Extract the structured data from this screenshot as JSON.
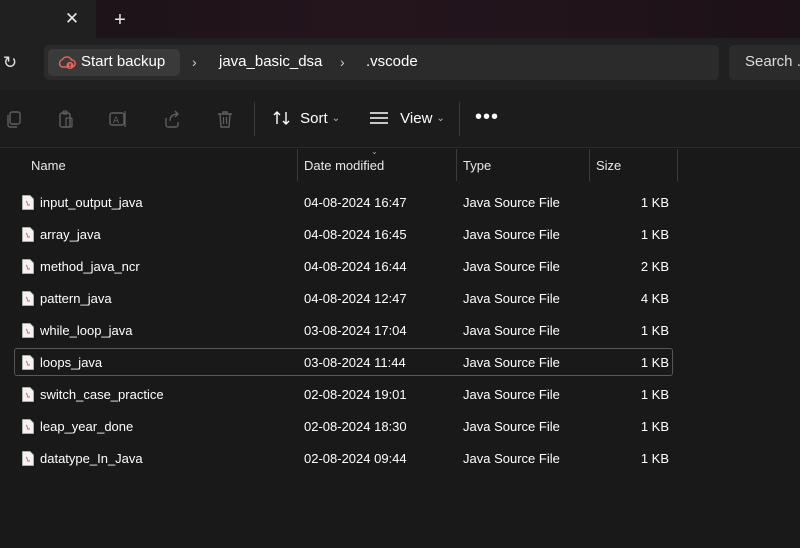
{
  "tabs": {
    "close_glyph": "✕",
    "new_glyph": "+"
  },
  "address": {
    "refresh_glyph": "↻",
    "crumbs": [
      "Start backup",
      "java_basic_dsa",
      ".vscode"
    ],
    "separator": "›",
    "search_text": "Search ."
  },
  "commandbar": {
    "icons": [
      "copy-icon",
      "paste-icon",
      "rename-icon",
      "share-icon",
      "delete-icon"
    ],
    "sort_label": "Sort",
    "view_label": "View",
    "more_glyph": "•••",
    "chevron": "⌄"
  },
  "columns": {
    "name": "Name",
    "date": "Date modified",
    "type": "Type",
    "size": "Size"
  },
  "files": [
    {
      "name": "input_output_java",
      "date": "04-08-2024 16:47",
      "type": "Java Source File",
      "size": "1 KB"
    },
    {
      "name": "array_java",
      "date": "04-08-2024 16:45",
      "type": "Java Source File",
      "size": "1 KB"
    },
    {
      "name": "method_java_ncr",
      "date": "04-08-2024 16:44",
      "type": "Java Source File",
      "size": "2 KB"
    },
    {
      "name": "pattern_java",
      "date": "04-08-2024 12:47",
      "type": "Java Source File",
      "size": "4 KB"
    },
    {
      "name": "while_loop_java",
      "date": "03-08-2024 17:04",
      "type": "Java Source File",
      "size": "1 KB"
    },
    {
      "name": "loops_java",
      "date": "03-08-2024 11:44",
      "type": "Java Source File",
      "size": "1 KB",
      "focused": true
    },
    {
      "name": "switch_case_practice",
      "date": "02-08-2024 19:01",
      "type": "Java Source File",
      "size": "1 KB"
    },
    {
      "name": "leap_year_done",
      "date": "02-08-2024 18:30",
      "type": "Java Source File",
      "size": "1 KB"
    },
    {
      "name": "datatype_In_Java",
      "date": "02-08-2024 09:44",
      "type": "Java Source File",
      "size": "1 KB"
    }
  ],
  "colors": {
    "background": "#191919",
    "accent_backup": "#e8655a",
    "java_icon": "#d9534f"
  }
}
